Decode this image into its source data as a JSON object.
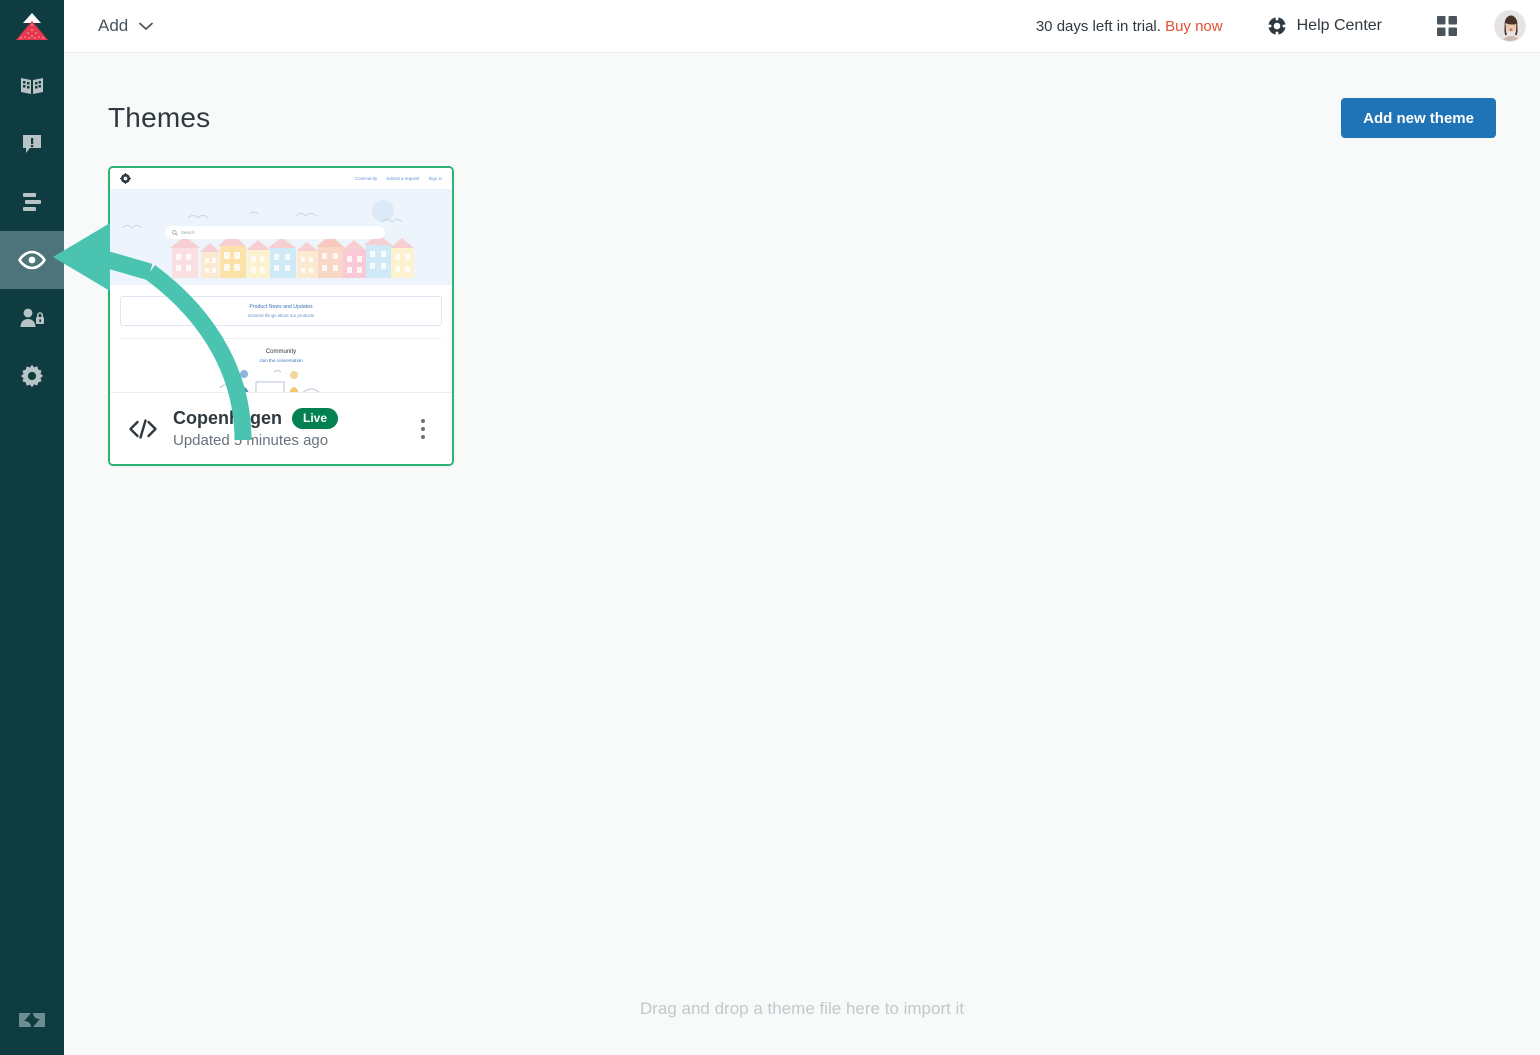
{
  "colors": {
    "sidebar_bg": "#0f3c41",
    "sidebar_active": "#4d7579",
    "accent_blue": "#1f73b7",
    "badge_green": "#038153",
    "card_border_green": "#2bb574",
    "trial_link_red": "#e34f32",
    "annotation_teal": "#4ac4b0"
  },
  "sidebar": {
    "logo_name": "guide-logo",
    "items": [
      {
        "icon": "book-icon",
        "label": "Knowledge base",
        "active": false
      },
      {
        "icon": "announcement-icon",
        "label": "Announcements",
        "active": false
      },
      {
        "icon": "arrange-articles-icon",
        "label": "Arrange articles",
        "active": false
      },
      {
        "icon": "eye-icon",
        "label": "Customize design",
        "active": true
      },
      {
        "icon": "user-lock-icon",
        "label": "User permissions",
        "active": false
      },
      {
        "icon": "gear-icon",
        "label": "Settings",
        "active": false
      }
    ],
    "footer_logo_name": "zendesk-logo"
  },
  "topbar": {
    "add_label": "Add",
    "trial_text": "30 days left in trial.",
    "buy_now_label": "Buy now",
    "help_center_label": "Help Center",
    "products_icon": "grid-icon",
    "avatar_name": "user-avatar"
  },
  "page": {
    "title": "Themes",
    "add_theme_button": "Add new theme",
    "dropzone_text": "Drag and drop a theme file here to import it"
  },
  "theme_card": {
    "name": "Copenhagen",
    "status_badge": "Live",
    "updated_text": "Updated 5 minutes ago",
    "code_icon": "code-icon",
    "menu_icon": "kebab-menu-icon",
    "preview": {
      "nav_links": [
        "Community",
        "Submit a request",
        "Sign in"
      ],
      "search_placeholder": "Search",
      "promo_title": "Product News and Updates",
      "promo_subtitle": "General things about our products",
      "community_title": "Community",
      "community_subtitle": "Join the conversation"
    }
  },
  "annotation": {
    "type": "curved-arrow",
    "points_to": "sidebar-item-customize-design"
  }
}
